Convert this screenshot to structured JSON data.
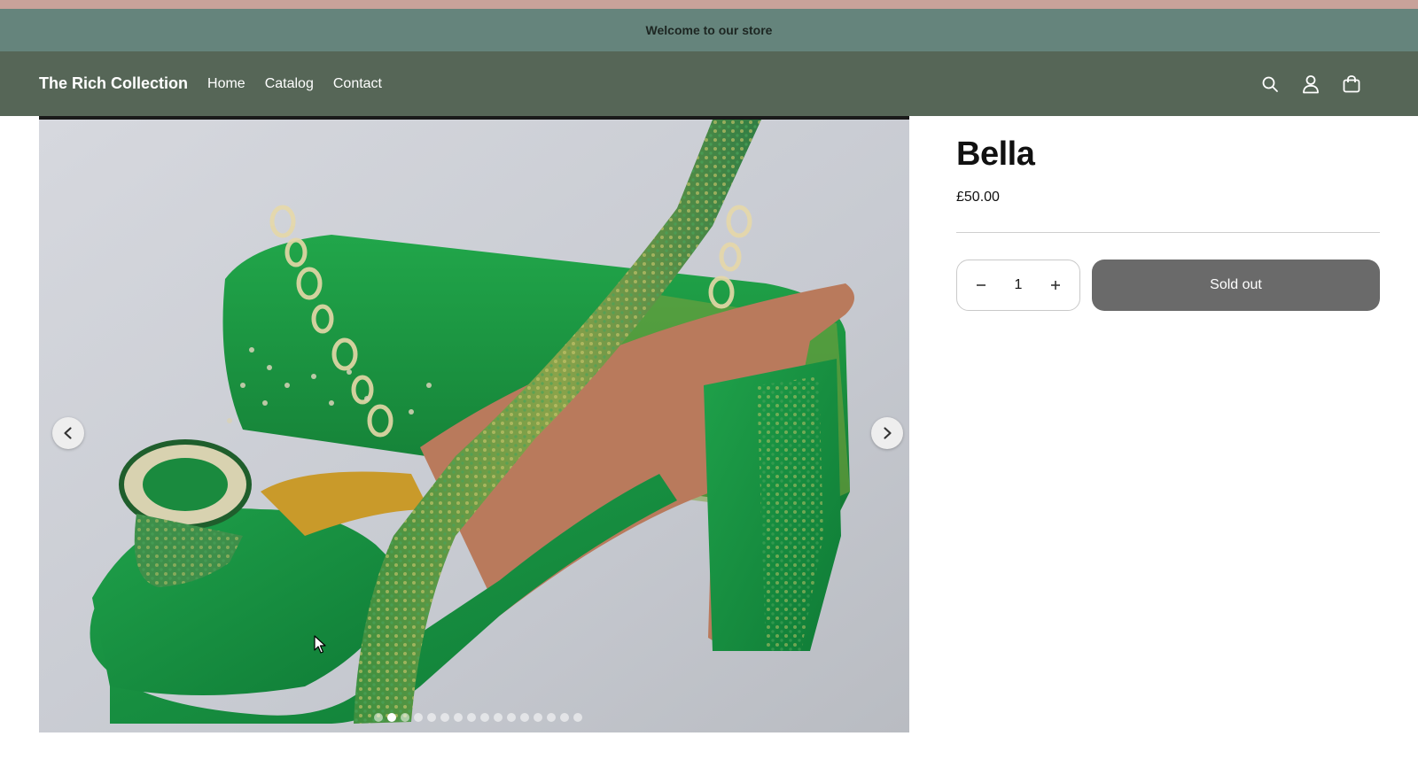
{
  "announcement": {
    "text": "Welcome to our store"
  },
  "header": {
    "logo": "The Rich Collection",
    "nav": [
      {
        "label": "Home"
      },
      {
        "label": "Catalog"
      },
      {
        "label": "Contact"
      }
    ],
    "icons": [
      "search-icon",
      "account-icon",
      "cart-icon"
    ]
  },
  "gallery": {
    "image_description_icon": "product-photo",
    "slide_count": 16,
    "active_slide": 1,
    "prev_icon": "chevron-left-icon",
    "next_icon": "chevron-right-icon"
  },
  "product": {
    "title": "Bella",
    "price": "£50.00",
    "quantity": "1",
    "sold_out_label": "Sold out"
  },
  "colors": {
    "top_strip": "#c8a29a",
    "announcement_bg": "#65847c",
    "header_bg": "#566657",
    "sold_out_bg": "#6a6a6a"
  }
}
